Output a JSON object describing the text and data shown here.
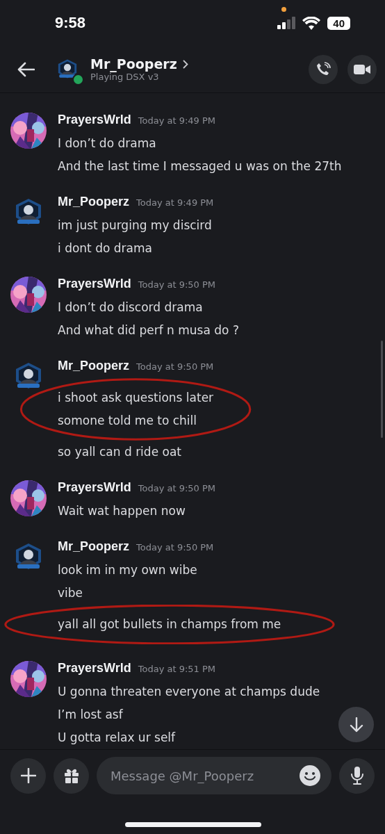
{
  "status_bar": {
    "time": "9:58",
    "battery": "40",
    "recording_indicator": true
  },
  "header": {
    "title": "Mr_Pooperz",
    "subtitle": "Playing DSX v3",
    "online": true
  },
  "messages": [
    {
      "author": "PrayersWrld",
      "kind": "round",
      "time": "Today at 9:49 PM",
      "lines": [
        {
          "text": "I don’t do drama",
          "circled": false
        },
        {
          "text": "And the last time I messaged u was on the 27th",
          "circled": false
        }
      ]
    },
    {
      "author": "Mr_Pooperz",
      "kind": "badge",
      "time": "Today at 9:49 PM",
      "lines": [
        {
          "text": "im just purging my discird",
          "circled": false
        },
        {
          "text": "i dont do drama",
          "circled": false
        }
      ]
    },
    {
      "author": "PrayersWrld",
      "kind": "round",
      "time": "Today at 9:50 PM",
      "lines": [
        {
          "text": "I don’t do discord drama",
          "circled": false
        },
        {
          "text": "And what did perf n musa do ?",
          "circled": false
        }
      ]
    },
    {
      "author": "Mr_Pooperz",
      "kind": "badge",
      "time": "Today at 9:50 PM",
      "lines": [
        {
          "text": "i shoot ask questions later",
          "circled": true
        },
        {
          "text": "somone told me to chill",
          "circled": true
        },
        {
          "text": "so yall can d ride oat",
          "circled": false
        }
      ]
    },
    {
      "author": "PrayersWrld",
      "kind": "round",
      "time": "Today at 9:50 PM",
      "lines": [
        {
          "text": "Wait wat happen now",
          "circled": false
        }
      ]
    },
    {
      "author": "Mr_Pooperz",
      "kind": "badge",
      "time": "Today at 9:50 PM",
      "lines": [
        {
          "text": "look im in my own wibe",
          "circled": false
        },
        {
          "text": "vibe",
          "circled": false
        },
        {
          "text": "yall all got bullets in champs from me",
          "circled": true
        }
      ]
    },
    {
      "author": "PrayersWrld",
      "kind": "round",
      "time": "Today at 9:51 PM",
      "lines": [
        {
          "text": "U gonna threaten everyone at champs dude",
          "circled": false
        },
        {
          "text": "I’m lost asf",
          "circled": false
        },
        {
          "text": "U gotta relax ur self",
          "circled": false
        }
      ]
    }
  ],
  "composer": {
    "placeholder": "Message @Mr_Pooperz"
  }
}
